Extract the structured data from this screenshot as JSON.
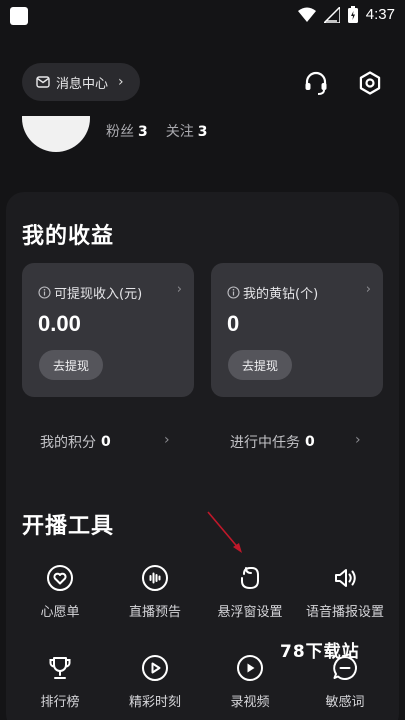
{
  "status_bar": {
    "time": "4:37"
  },
  "header": {
    "message_center_label": "消息中心",
    "fans_label": "粉丝",
    "fans_count": "3",
    "follow_label": "关注",
    "follow_count": "3"
  },
  "earnings": {
    "title": "我的收益",
    "cards": [
      {
        "label": "可提现收入(元)",
        "value": "0.00",
        "button": "去提现"
      },
      {
        "label": "我的黄钻(个)",
        "value": "0",
        "button": "去提现"
      }
    ],
    "points_label": "我的积分",
    "points_value": "0",
    "tasks_label": "进行中任务",
    "tasks_value": "0"
  },
  "tools": {
    "title": "开播工具",
    "items": [
      {
        "label": "心愿单",
        "icon": "heart-icon"
      },
      {
        "label": "直播预告",
        "icon": "soundwave-icon"
      },
      {
        "label": "悬浮窗设置",
        "icon": "floating-window-icon"
      },
      {
        "label": "语音播报设置",
        "icon": "speaker-icon"
      },
      {
        "label": "排行榜",
        "icon": "trophy-icon"
      },
      {
        "label": "精彩时刻",
        "icon": "play-circle-icon"
      },
      {
        "label": "录视频",
        "icon": "record-video-icon"
      },
      {
        "label": "敏感词",
        "icon": "chat-bubble-icon"
      }
    ]
  },
  "watermark": "78下载站",
  "colors": {
    "background": "#141416",
    "panel": "#1c1c1f",
    "card": "#36363b",
    "annotation_arrow": "#c0182a"
  }
}
